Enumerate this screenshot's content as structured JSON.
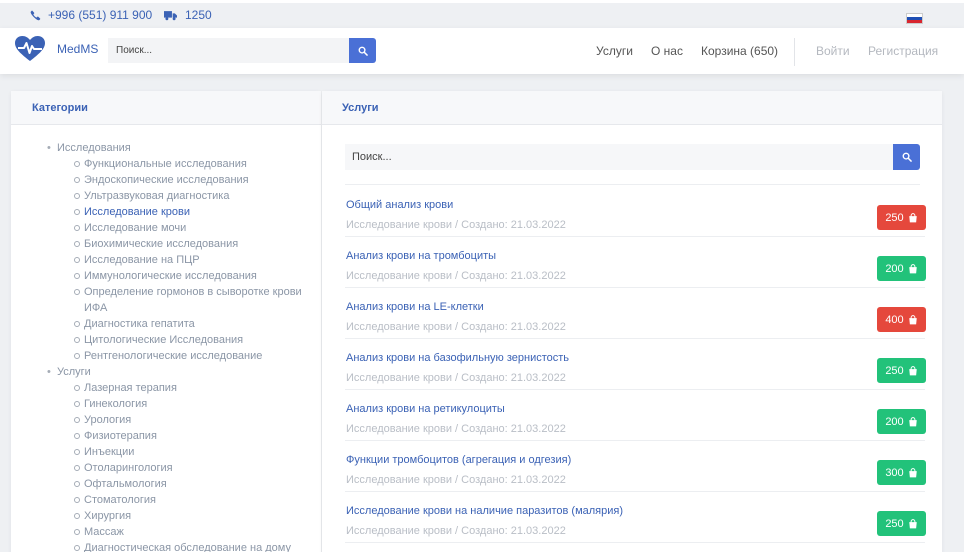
{
  "topbar": {
    "phone": "+996 (551) 911 900",
    "phone_icon": "phone-icon",
    "delivery_count": "1250",
    "delivery_icon": "truck-icon",
    "language_flag": "flag-ru-icon",
    "flag_colors": [
      "#ffffff",
      "#1f4fb4",
      "#d8262f"
    ]
  },
  "header": {
    "brand": "MedMS",
    "logo_icon": "heart-pulse-icon",
    "search_placeholder": "Поиск...",
    "nav": {
      "services": "Услуги",
      "about": "О нас",
      "cart": "Корзина (650)",
      "login": "Войти",
      "register": "Регистрация"
    }
  },
  "categories": {
    "title": "Категории",
    "groups": [
      {
        "label": "Исследования",
        "items": [
          "Функциональные исследования",
          "Эндоскопические исследования",
          "Ультразвуковая диагностика",
          "Исследование крови",
          "Исследование мочи",
          "Биохимические исследования",
          "Исследование на ПЦР",
          "Иммунологические исследования",
          "Определение гормонов в сыворотке крови ИФА",
          "Диагностика гепатита",
          "Цитологические Исследования",
          "Рентгенологические исследование"
        ]
      },
      {
        "label": "Услуги",
        "items": [
          "Лазерная терапия",
          "Гинекология",
          "Урология",
          "Физиотерапия",
          "Инъекции",
          "Отоларингология",
          "Офтальмология",
          "Стоматология",
          "Хирургия",
          "Массаж",
          "Диагностическая обследование на дому"
        ]
      }
    ]
  },
  "services": {
    "title": "Услуги",
    "search_placeholder": "Поиск...",
    "items": [
      {
        "title": "Общий анализ крови",
        "meta": "Исследование крови / Создано: 21.03.2022",
        "price": "250",
        "price_color": "red"
      },
      {
        "title": "Анализ крови на тромбоциты",
        "meta": "Исследование крови / Создано: 21.03.2022",
        "price": "200",
        "price_color": "green"
      },
      {
        "title": "Анализ крови на LE-клетки",
        "meta": "Исследование крови / Создано: 21.03.2022",
        "price": "400",
        "price_color": "red"
      },
      {
        "title": "Анализ крови на базофильную зернистость",
        "meta": "Исследование крови / Создано: 21.03.2022",
        "price": "250",
        "price_color": "green"
      },
      {
        "title": "Анализ крови на ретикулоциты",
        "meta": "Исследование крови / Создано: 21.03.2022",
        "price": "200",
        "price_color": "green"
      },
      {
        "title": "Функции тромбоцитов (агрегация и одгезия)",
        "meta": "Исследование крови / Создано: 21.03.2022",
        "price": "300",
        "price_color": "green"
      },
      {
        "title": "Исследование крови на наличие паразитов (малярия)",
        "meta": "Исследование крови / Создано: 21.03.2022",
        "price": "250",
        "price_color": "green"
      }
    ]
  },
  "colors": {
    "accent": "#3b62b5",
    "button_blue": "#4a70d6",
    "price_red": "#e5483c",
    "price_green": "#22c27a"
  }
}
